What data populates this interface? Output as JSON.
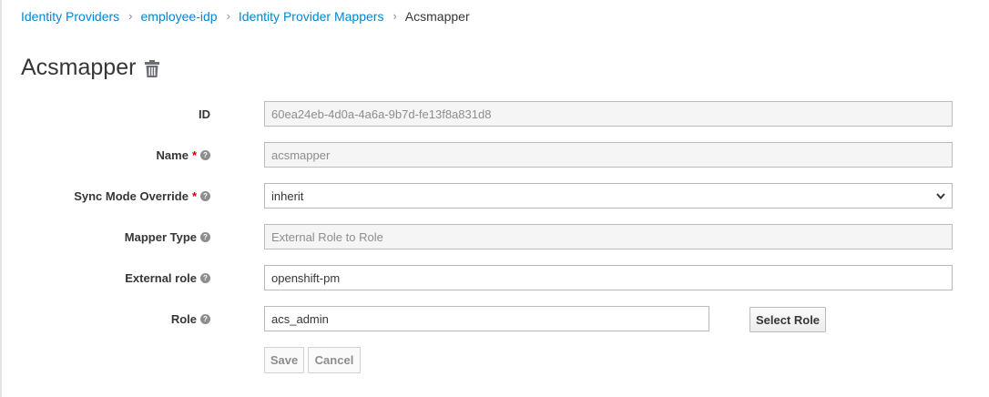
{
  "breadcrumb": {
    "items": [
      "Identity Providers",
      "employee-idp",
      "Identity Provider Mappers"
    ],
    "current": "Acsmapper"
  },
  "page": {
    "title": "Acsmapper",
    "delete_icon": "trash-icon"
  },
  "form": {
    "id": {
      "label": "ID",
      "value": "60ea24eb-4d0a-4a6a-9b7d-fe13f8a831d8"
    },
    "name": {
      "label": "Name",
      "value": "acsmapper",
      "required": "*"
    },
    "sync_mode": {
      "label": "Sync Mode Override",
      "value": "inherit",
      "required": "*"
    },
    "mapper_type": {
      "label": "Mapper Type",
      "value": "External Role to Role"
    },
    "external_role": {
      "label": "External role",
      "value": "openshift-pm"
    },
    "role": {
      "label": "Role",
      "value": "acs_admin",
      "select_button": "Select Role"
    },
    "help_icon": "question-circle-icon"
  },
  "actions": {
    "save": "Save",
    "cancel": "Cancel"
  },
  "colors": {
    "link": "#0088ce",
    "required": "#cc0000",
    "readonly_bg": "#f5f5f5"
  }
}
